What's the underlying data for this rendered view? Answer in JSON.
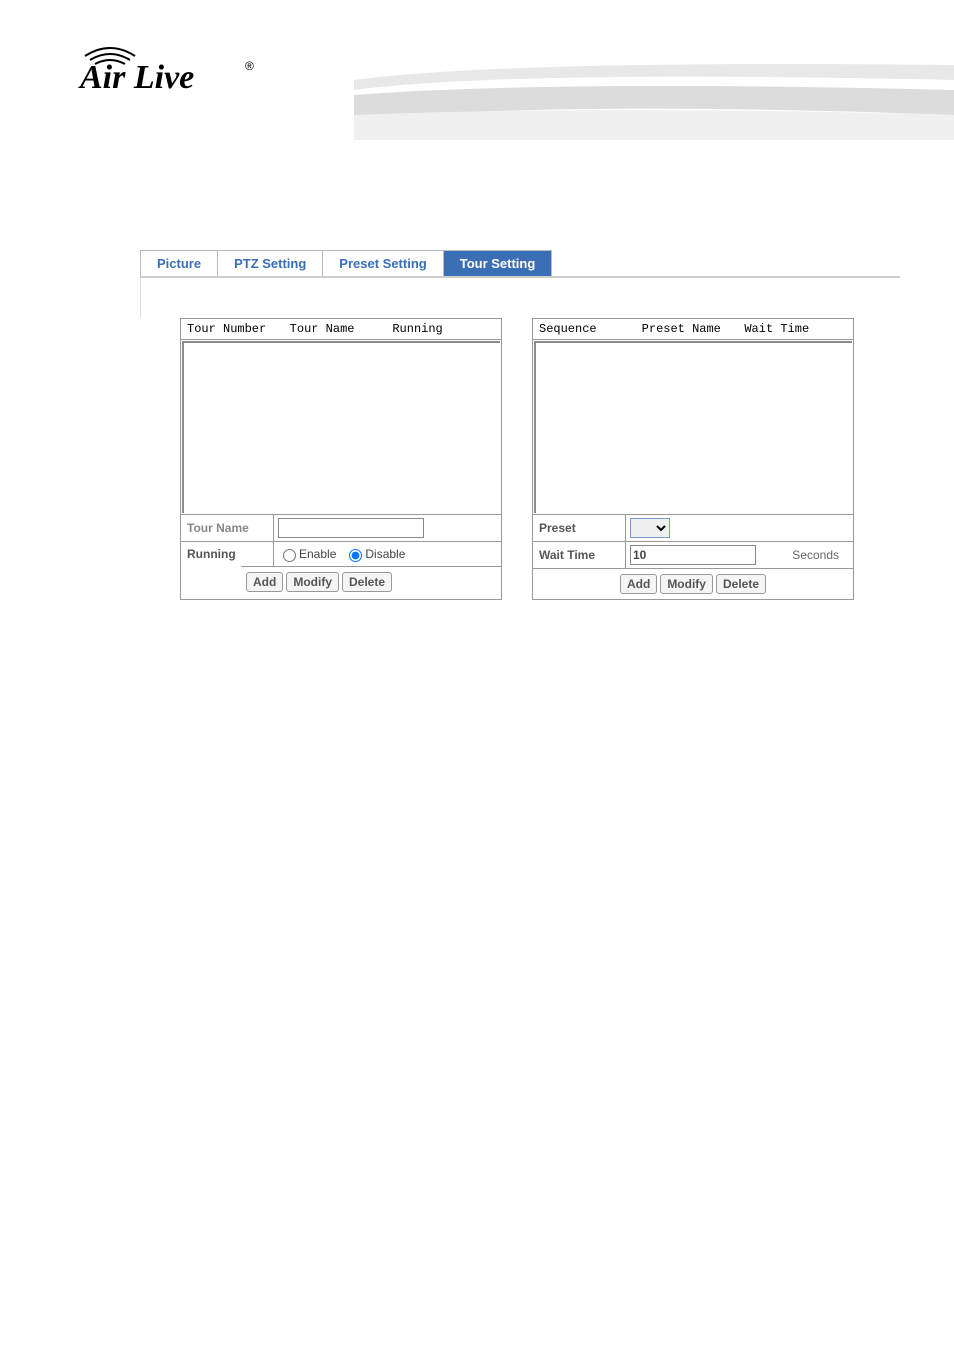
{
  "logo_text": "AirLive",
  "tabs": {
    "picture": "Picture",
    "ptz": "PTZ Setting",
    "preset": "Preset Setting",
    "tour": "Tour Setting"
  },
  "left_panel": {
    "col1": "Tour Number",
    "col2": "Tour Name",
    "col3": "Running",
    "tour_name_label": "Tour Name",
    "tour_name_value": "",
    "running_label": "Running",
    "enable_label": "Enable",
    "disable_label": "Disable",
    "add": "Add",
    "modify": "Modify",
    "delete": "Delete"
  },
  "right_panel": {
    "col1": "Sequence",
    "col2": "Preset Name",
    "col3": "Wait Time",
    "preset_label": "Preset",
    "preset_value": "",
    "wait_label": "Wait Time",
    "wait_value": "10",
    "wait_suffix": "Seconds",
    "add": "Add",
    "modify": "Modify",
    "delete": "Delete"
  }
}
